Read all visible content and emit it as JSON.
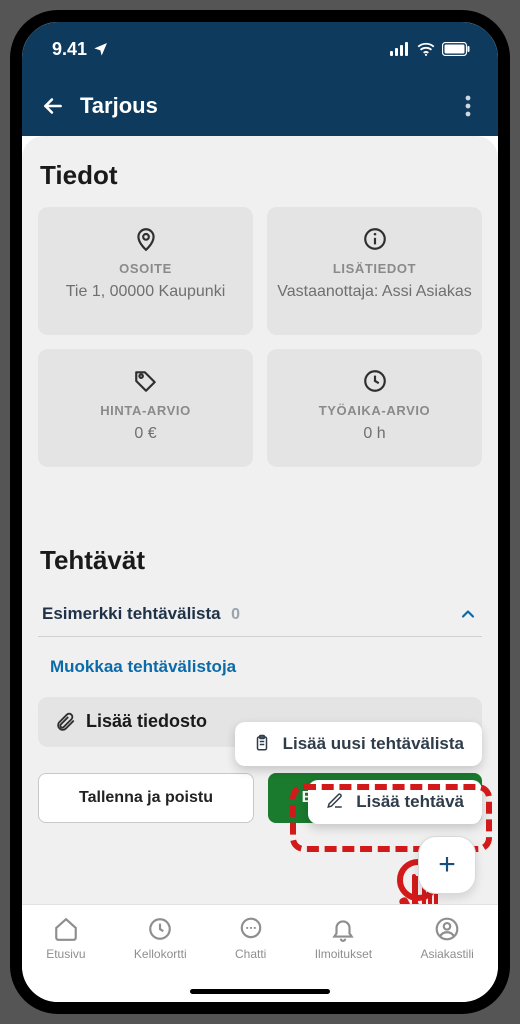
{
  "status_bar": {
    "time": "9.41"
  },
  "header": {
    "title": "Tarjous"
  },
  "tiedot": {
    "heading": "Tiedot",
    "address_label": "OSOITE",
    "address_value": "Tie 1, 00000 Kaupunki",
    "info_label": "LISÄTIEDOT",
    "info_value": "Vastaanottaja: Assi Asiakas",
    "price_label": "HINTA-ARVIO",
    "price_value": "0 €",
    "time_label": "TYÖAIKA-ARVIO",
    "time_value": "0 h"
  },
  "tehtavat": {
    "heading": "Tehtävät",
    "list_name": "Esimerkki tehtävälista",
    "list_count": "0",
    "edit_lists": "Muokkaa tehtävälistoja",
    "add_file": "Lisää tiedosto"
  },
  "popup": {
    "add_list": "Lisää uusi tehtävälista",
    "add_task": "Lisää tehtävä"
  },
  "buttons": {
    "save_exit": "Tallenna ja poistu",
    "preview_send": "Esikatsele ja lähetä"
  },
  "tabs": {
    "home": "Etusivu",
    "timecard": "Kellokortti",
    "chat": "Chatti",
    "notifications": "Ilmoitukset",
    "account": "Asiakastili"
  }
}
